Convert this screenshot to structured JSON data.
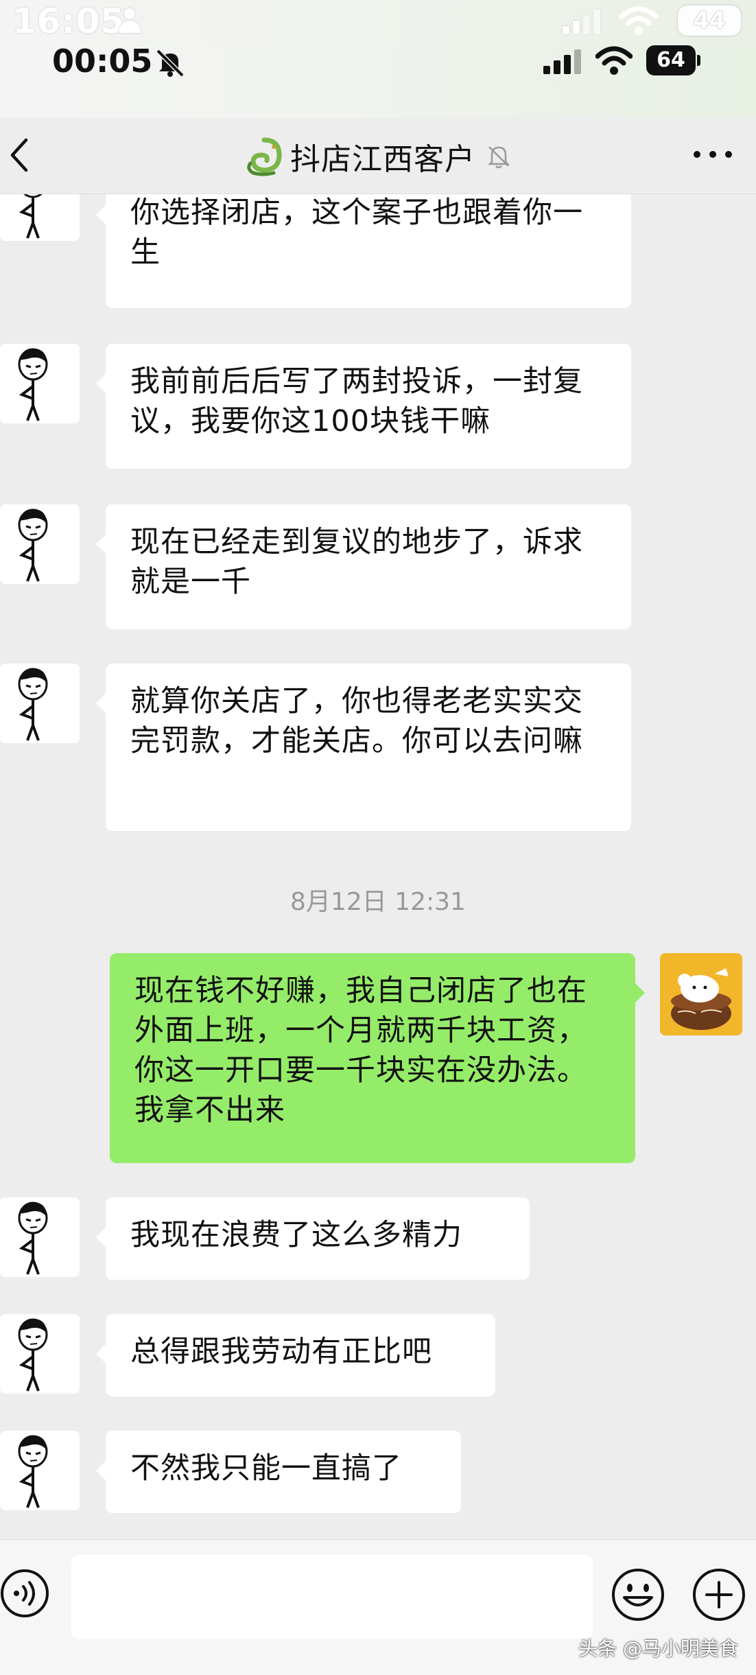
{
  "outer_status": {
    "time": "16:05",
    "battery": "44"
  },
  "status_bar": {
    "time": "00:05",
    "battery": "64"
  },
  "header": {
    "title": "抖店江西客户",
    "back_icon": "chevron-left-icon",
    "more_icon": "more-dots-icon",
    "mute_icon": "bell-off-icon"
  },
  "messages": [
    {
      "side": "left",
      "text": "你选择闭店，这个案子也跟着你一生"
    },
    {
      "side": "left",
      "text": "我前前后后写了两封投诉，一封复议，我要你这100块钱干嘛"
    },
    {
      "side": "left",
      "text": "现在已经走到复议的地步了，诉求就是一千"
    },
    {
      "side": "left",
      "text": "就算你关店了，你也得老老实实交完罚款，才能关店。你可以去问嘛"
    },
    {
      "side": "right",
      "text": "现在钱不好赚，我自己闭店了也在外面上班，一个月就两千块工资，你这一开口要一千块实在没办法。我拿不出来"
    },
    {
      "side": "left",
      "text": "我现在浪费了这么多精力"
    },
    {
      "side": "left",
      "text": "总得跟我劳动有正比吧"
    },
    {
      "side": "left",
      "text": "不然我只能一直搞了"
    }
  ],
  "timestamp": "8月12日 12:31",
  "input_bar": {
    "placeholder": "",
    "voice_icon": "voice-icon",
    "emoji_icon": "emoji-icon",
    "plus_icon": "plus-icon"
  },
  "watermark": "头条 @马小明美食",
  "colors": {
    "background": "#ededed",
    "bubble_left": "#ffffff",
    "bubble_right": "#95ec69"
  }
}
